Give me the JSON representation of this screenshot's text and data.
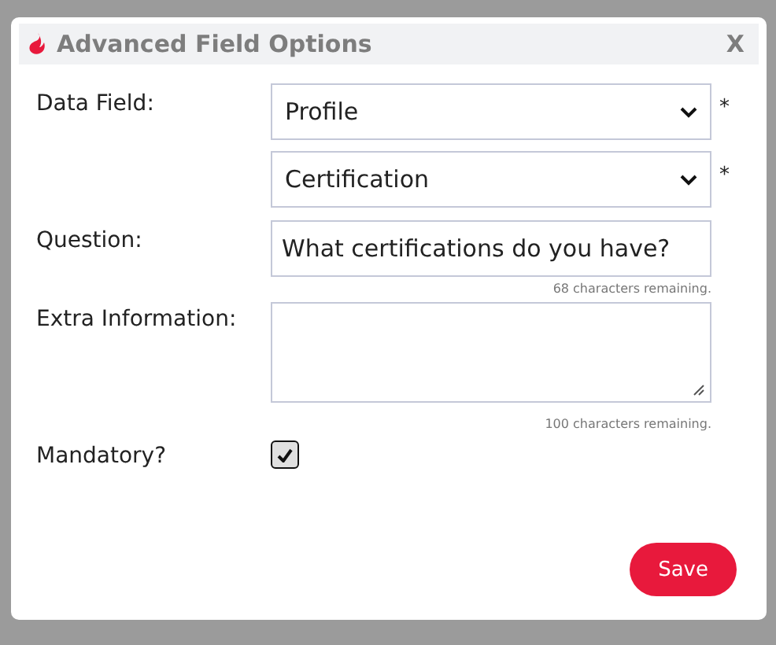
{
  "dialog": {
    "title": "Advanced Field Options",
    "close": "X"
  },
  "fields": [
    {
      "kind": "select",
      "label": "Data Field:",
      "value": "Profile",
      "required_mark": "*"
    },
    {
      "kind": "select",
      "value": "Certification",
      "required_mark": "*"
    },
    {
      "kind": "input",
      "label": "Question:",
      "value": "What certifications do you have?",
      "hint": "68 characters remaining."
    },
    {
      "kind": "textarea",
      "label": "Extra Information:",
      "hint": "100 characters remaining."
    },
    {
      "kind": "checkbox",
      "label": "Mandatory?",
      "checked": true
    }
  ],
  "buttons": [
    {
      "label": "Save"
    }
  ]
}
